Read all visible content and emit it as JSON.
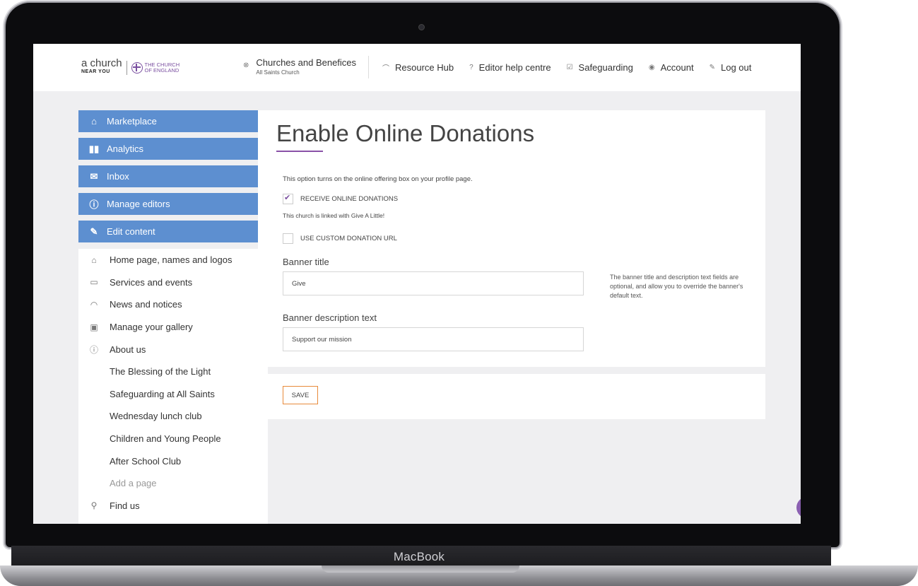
{
  "device": {
    "brand": "MacBook"
  },
  "header": {
    "logo_line1": "a church",
    "logo_line2": "NEAR YOU",
    "logo_coe": "THE CHURCH OF ENGLAND",
    "church_title": "Churches and Benefices",
    "church_sub": "All Saints Church",
    "nav": [
      "Resource Hub",
      "Editor help centre",
      "Safeguarding",
      "Account",
      "Log out"
    ]
  },
  "sidebar": {
    "menu": [
      "Marketplace",
      "Analytics",
      "Inbox",
      "Manage editors",
      "Edit content"
    ],
    "sections": [
      "Home page, names and logos",
      "Services and events",
      "News and notices",
      "Manage your gallery",
      "About us"
    ],
    "pages": [
      "The Blessing of the Light",
      "Safeguarding at All Saints",
      "Wednesday lunch club",
      "Children and Young People",
      "After School Club",
      "Add a page"
    ],
    "find_us": "Find us"
  },
  "main": {
    "title": "Enable Online Donations",
    "intro": "This option turns on the online offering box on your profile page.",
    "receive_label": "RECEIVE ONLINE DONATIONS",
    "linked_text": "This church is linked with Give A Little!",
    "custom_url_label": "USE CUSTOM DONATION URL",
    "banner_title_label": "Banner title",
    "banner_title_value": "Give",
    "banner_desc_label": "Banner description text",
    "banner_desc_value": "Support our mission",
    "help_text": "The banner title and description text fields are optional, and allow you to override the banner's default text.",
    "save_label": "SAVE"
  },
  "colors": {
    "menu_blue": "#5d8fd0",
    "accent_purple": "#8a52a8",
    "save_orange": "#e88a3a"
  }
}
